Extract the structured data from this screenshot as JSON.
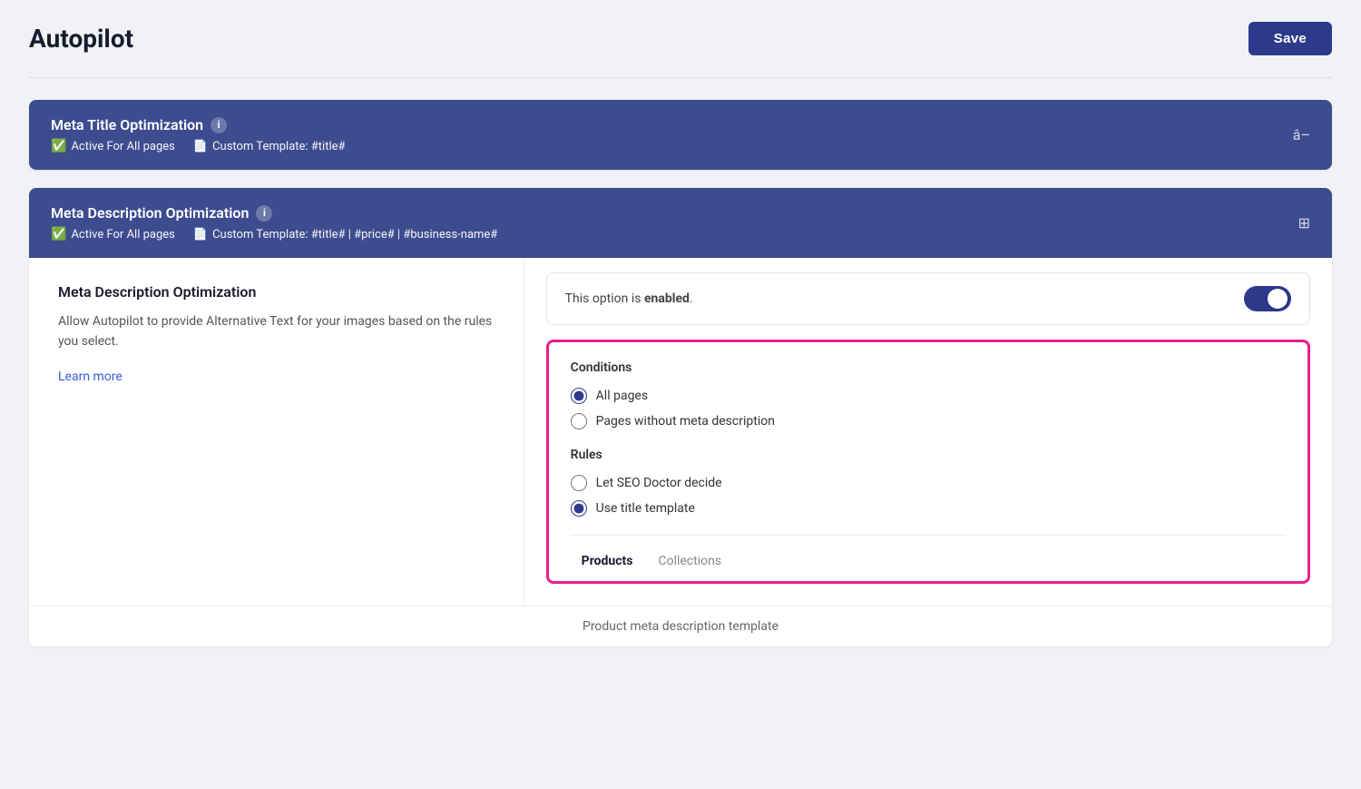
{
  "page": {
    "title": "Autopilot",
    "save_button_label": "Save"
  },
  "meta_title_section": {
    "header_title": "Meta Title Optimization",
    "info_icon_label": "i",
    "active_status": "Active For All pages",
    "template_label": "Custom Template: #title#",
    "action_symbol": "â–"
  },
  "meta_description_section": {
    "header_title": "Meta Description Optimization",
    "info_icon_label": "i",
    "active_status": "Active For All pages",
    "template_label": "Custom Template: #title# | #price# | #business-name#",
    "action_symbol": "⊞"
  },
  "meta_description_content": {
    "left_title": "Meta Description Optimization",
    "left_desc": "Allow Autopilot to provide Alternative Text for your images based on the rules you select.",
    "learn_more_label": "Learn more",
    "toggle_text_prefix": "This option is ",
    "toggle_text_bold": "enabled",
    "toggle_text_suffix": ".",
    "toggle_enabled": true
  },
  "conditions": {
    "title": "Conditions",
    "options": [
      {
        "id": "all-pages",
        "label": "All pages",
        "checked": true
      },
      {
        "id": "pages-without",
        "label": "Pages without meta description",
        "checked": false
      }
    ]
  },
  "rules": {
    "title": "Rules",
    "options": [
      {
        "id": "let-seo",
        "label": "Let SEO Doctor decide",
        "checked": false
      },
      {
        "id": "use-title",
        "label": "Use title template",
        "checked": true
      }
    ]
  },
  "sub_tabs": [
    {
      "id": "products",
      "label": "Products",
      "active": true
    },
    {
      "id": "collections",
      "label": "Collections",
      "active": false
    }
  ],
  "bottom_hint": {
    "label": "Product meta description template"
  }
}
